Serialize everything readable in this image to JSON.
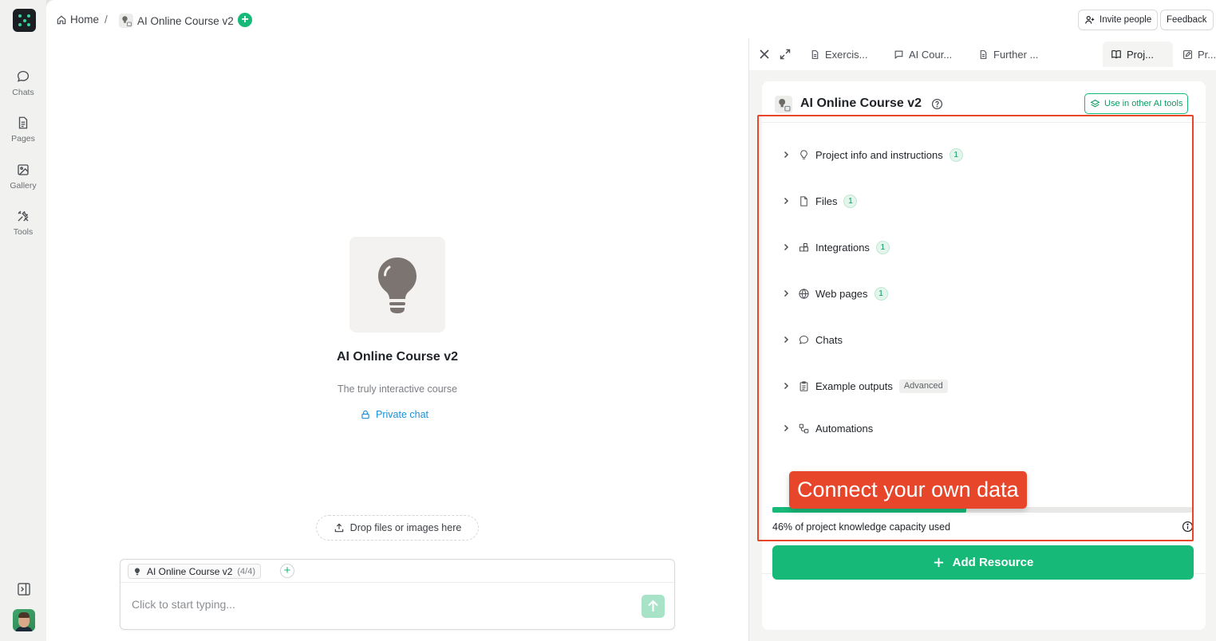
{
  "sidebar": {
    "items": [
      {
        "label": "Chats",
        "icon": "chat-bubble-icon"
      },
      {
        "label": "Pages",
        "icon": "document-icon"
      },
      {
        "label": "Gallery",
        "icon": "image-icon"
      },
      {
        "label": "Tools",
        "icon": "tools-icon"
      }
    ],
    "bottom_icon": "sidebar-toggle-icon",
    "avatar": "user-avatar"
  },
  "header": {
    "home_label": "Home",
    "separator": "/",
    "project_label": "AI Online Course v2",
    "invite_label": "Invite people",
    "feedback_label": "Feedback"
  },
  "chat": {
    "title": "AI Online Course v2",
    "subtitle": "The truly interactive course",
    "privacy_label": "Private chat",
    "drop_label": "Drop files or images here",
    "context_chip": {
      "label": "AI Online Course v2",
      "count": "(4/4)"
    },
    "input_placeholder": "Click to start typing..."
  },
  "panel": {
    "tabs": [
      {
        "label": "Exercis...",
        "icon": "document-icon"
      },
      {
        "label": "AI Cour...",
        "icon": "chat-bubble-icon"
      },
      {
        "label": "Further ...",
        "icon": "document-icon"
      },
      {
        "label": "Proj...",
        "icon": "book-icon",
        "active": true
      },
      {
        "label": "Pr...",
        "icon": "edit-icon"
      }
    ],
    "project_title": "AI Online Course v2",
    "use_button": "Use in other AI tools",
    "sections": [
      {
        "label": "Project info and instructions",
        "icon": "lightbulb-icon",
        "badge": "1"
      },
      {
        "label": "Files",
        "icon": "file-icon",
        "badge": "1"
      },
      {
        "label": "Integrations",
        "icon": "integrations-icon",
        "badge": "1"
      },
      {
        "label": "Web pages",
        "icon": "globe-icon",
        "badge": "1"
      },
      {
        "label": "Chats",
        "icon": "chat-bubble-icon"
      },
      {
        "label": "Example outputs",
        "icon": "clipboard-icon",
        "tag": "Advanced"
      },
      {
        "label": "Automations",
        "icon": "automations-icon"
      }
    ],
    "capacity_percent": 46,
    "capacity_text": "46% of project knowledge capacity used",
    "add_resource_label": "Add Resource"
  },
  "annotation": {
    "callout_text": "Connect your own data",
    "color": "#e8462a"
  },
  "colors": {
    "accent": "#17b978",
    "link": "#1b8fd6",
    "annotation": "#e8462a"
  }
}
